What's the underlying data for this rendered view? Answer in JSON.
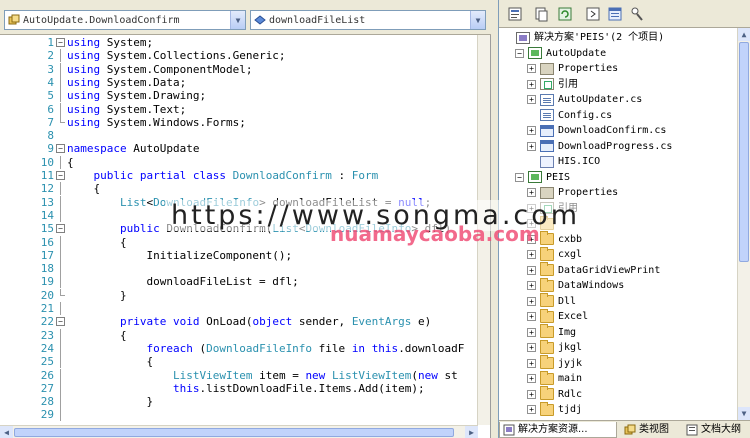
{
  "editor": {
    "class_combo": "AutoUpdate.DownloadConfirm",
    "member_combo": "downloadFileList",
    "lines": [
      {
        "n": "1",
        "fold": "minus",
        "tokens": [
          [
            "kw",
            "using"
          ],
          [
            "t",
            " System;"
          ]
        ]
      },
      {
        "n": "2",
        "fold": "line",
        "tokens": [
          [
            "kw",
            "using"
          ],
          [
            "t",
            " System.Collections.Generic;"
          ]
        ]
      },
      {
        "n": "3",
        "fold": "line",
        "tokens": [
          [
            "kw",
            "using"
          ],
          [
            "t",
            " System.ComponentModel;"
          ]
        ]
      },
      {
        "n": "4",
        "fold": "line",
        "tokens": [
          [
            "kw",
            "using"
          ],
          [
            "t",
            " System.Data;"
          ]
        ]
      },
      {
        "n": "5",
        "fold": "line",
        "tokens": [
          [
            "kw",
            "using"
          ],
          [
            "t",
            " System.Drawing;"
          ]
        ]
      },
      {
        "n": "6",
        "fold": "line",
        "tokens": [
          [
            "kw",
            "using"
          ],
          [
            "t",
            " System.Text;"
          ]
        ]
      },
      {
        "n": "7",
        "fold": "end",
        "tokens": [
          [
            "kw",
            "using"
          ],
          [
            "t",
            " System.Windows.Forms;"
          ]
        ]
      },
      {
        "n": "8",
        "fold": "",
        "tokens": []
      },
      {
        "n": "9",
        "fold": "minus",
        "tokens": [
          [
            "kw",
            "namespace"
          ],
          [
            "t",
            " AutoUpdate"
          ]
        ]
      },
      {
        "n": "10",
        "fold": "line",
        "tokens": [
          [
            "t",
            "{"
          ]
        ]
      },
      {
        "n": "11",
        "fold": "minus",
        "tokens": [
          [
            "t",
            "    "
          ],
          [
            "kw",
            "public partial class"
          ],
          [
            "t",
            " "
          ],
          [
            "ty",
            "DownloadConfirm"
          ],
          [
            "t",
            " : "
          ],
          [
            "ty",
            "Form"
          ]
        ]
      },
      {
        "n": "12",
        "fold": "line",
        "tokens": [
          [
            "t",
            "    {"
          ]
        ]
      },
      {
        "n": "13",
        "fold": "line",
        "tokens": [
          [
            "t",
            "        "
          ],
          [
            "ty",
            "List"
          ],
          [
            "t",
            "<"
          ],
          [
            "ty",
            "DownloadFileInfo"
          ],
          [
            "t",
            "> downloadFileList = "
          ],
          [
            "kw",
            "null"
          ],
          [
            "t",
            ";"
          ]
        ]
      },
      {
        "n": "14",
        "fold": "line",
        "tokens": []
      },
      {
        "n": "15",
        "fold": "minus",
        "tokens": [
          [
            "t",
            "        "
          ],
          [
            "kw",
            "public"
          ],
          [
            "t",
            " DownloadConfirm("
          ],
          [
            "ty",
            "List"
          ],
          [
            "t",
            "<"
          ],
          [
            "ty",
            "DownloadFileInfo"
          ],
          [
            "t",
            "> dfl)"
          ]
        ]
      },
      {
        "n": "16",
        "fold": "line",
        "tokens": [
          [
            "t",
            "        {"
          ]
        ]
      },
      {
        "n": "17",
        "fold": "line",
        "tokens": [
          [
            "t",
            "            InitializeComponent();"
          ]
        ]
      },
      {
        "n": "18",
        "fold": "line",
        "tokens": []
      },
      {
        "n": "19",
        "fold": "line",
        "tokens": [
          [
            "t",
            "            downloadFileList = dfl;"
          ]
        ]
      },
      {
        "n": "20",
        "fold": "end",
        "tokens": [
          [
            "t",
            "        }"
          ]
        ]
      },
      {
        "n": "21",
        "fold": "line",
        "tokens": []
      },
      {
        "n": "22",
        "fold": "minus",
        "tokens": [
          [
            "t",
            "        "
          ],
          [
            "kw",
            "private void"
          ],
          [
            "t",
            " OnLoad("
          ],
          [
            "kw",
            "object"
          ],
          [
            "t",
            " sender, "
          ],
          [
            "ty",
            "EventArgs"
          ],
          [
            "t",
            " e)"
          ]
        ]
      },
      {
        "n": "23",
        "fold": "line",
        "tokens": [
          [
            "t",
            "        {"
          ]
        ]
      },
      {
        "n": "24",
        "fold": "line",
        "tokens": [
          [
            "t",
            "            "
          ],
          [
            "kw",
            "foreach"
          ],
          [
            "t",
            " ("
          ],
          [
            "ty",
            "DownloadFileInfo"
          ],
          [
            "t",
            " file "
          ],
          [
            "kw",
            "in"
          ],
          [
            "t",
            " "
          ],
          [
            "kw",
            "this"
          ],
          [
            "t",
            ".downloadF"
          ]
        ]
      },
      {
        "n": "25",
        "fold": "line",
        "tokens": [
          [
            "t",
            "            {"
          ]
        ]
      },
      {
        "n": "26",
        "fold": "line",
        "tokens": [
          [
            "t",
            "                "
          ],
          [
            "ty",
            "ListViewItem"
          ],
          [
            "t",
            " item = "
          ],
          [
            "kw",
            "new"
          ],
          [
            "t",
            " "
          ],
          [
            "ty",
            "ListViewItem"
          ],
          [
            "t",
            "("
          ],
          [
            "kw",
            "new"
          ],
          [
            "t",
            " st"
          ]
        ]
      },
      {
        "n": "27",
        "fold": "line",
        "tokens": [
          [
            "t",
            "                "
          ],
          [
            "kw",
            "this"
          ],
          [
            "t",
            ".listDownloadFile.Items.Add(item);"
          ]
        ]
      },
      {
        "n": "28",
        "fold": "line",
        "tokens": [
          [
            "t",
            "            }"
          ]
        ]
      },
      {
        "n": "29",
        "fold": "line",
        "tokens": []
      }
    ]
  },
  "solution": {
    "nodes": [
      {
        "indent": 0,
        "exp": "",
        "icon": "sln",
        "label": "解决方案'PEIS'(2 个项目)",
        "name": "solution-root"
      },
      {
        "indent": 1,
        "exp": "-",
        "icon": "proj",
        "label": "AutoUpdate",
        "name": "project-autoupdate"
      },
      {
        "indent": 2,
        "exp": "+",
        "icon": "props",
        "label": "Properties",
        "name": "node-properties"
      },
      {
        "indent": 2,
        "exp": "+",
        "icon": "refs",
        "label": "引用",
        "name": "node-references"
      },
      {
        "indent": 2,
        "exp": "+",
        "icon": "cs",
        "label": "AutoUpdater.cs",
        "name": "file-autoupdater"
      },
      {
        "indent": 2,
        "exp": "",
        "icon": "cs",
        "label": "Config.cs",
        "name": "file-config"
      },
      {
        "indent": 2,
        "exp": "+",
        "icon": "form",
        "label": "DownloadConfirm.cs",
        "name": "file-downloadconfirm"
      },
      {
        "indent": 2,
        "exp": "+",
        "icon": "form",
        "label": "DownloadProgress.cs",
        "name": "file-downloadprogress"
      },
      {
        "indent": 2,
        "exp": "",
        "icon": "file",
        "label": "HIS.ICO",
        "name": "file-his-ico"
      },
      {
        "indent": 1,
        "exp": "-",
        "icon": "proj",
        "label": "PEIS",
        "name": "project-peis"
      },
      {
        "indent": 2,
        "exp": "+",
        "icon": "props",
        "label": "Properties",
        "name": "node-properties"
      },
      {
        "indent": 2,
        "exp": "+",
        "icon": "refs",
        "label": "引用",
        "name": "node-references"
      },
      {
        "indent": 2,
        "exp": "+",
        "icon": "folder",
        "label": "",
        "name": "folder-item"
      },
      {
        "indent": 2,
        "exp": "+",
        "icon": "folder",
        "label": "cxbb",
        "name": "folder-item"
      },
      {
        "indent": 2,
        "exp": "+",
        "icon": "folder",
        "label": "cxgl",
        "name": "folder-item"
      },
      {
        "indent": 2,
        "exp": "+",
        "icon": "folder",
        "label": "DataGridViewPrint",
        "name": "folder-item"
      },
      {
        "indent": 2,
        "exp": "+",
        "icon": "folder",
        "label": "DataWindows",
        "name": "folder-item"
      },
      {
        "indent": 2,
        "exp": "+",
        "icon": "folder",
        "label": "Dll",
        "name": "folder-item"
      },
      {
        "indent": 2,
        "exp": "+",
        "icon": "folder",
        "label": "Excel",
        "name": "folder-item"
      },
      {
        "indent": 2,
        "exp": "+",
        "icon": "folder",
        "label": "Img",
        "name": "folder-item"
      },
      {
        "indent": 2,
        "exp": "+",
        "icon": "folder",
        "label": "jkgl",
        "name": "folder-item"
      },
      {
        "indent": 2,
        "exp": "+",
        "icon": "folder",
        "label": "jyjk",
        "name": "folder-item"
      },
      {
        "indent": 2,
        "exp": "+",
        "icon": "folder",
        "label": "main",
        "name": "folder-item"
      },
      {
        "indent": 2,
        "exp": "+",
        "icon": "folder",
        "label": "Rdlc",
        "name": "folder-item"
      },
      {
        "indent": 2,
        "exp": "+",
        "icon": "folder",
        "label": "tjdj",
        "name": "folder-item"
      }
    ],
    "tabs": {
      "solution_explorer": "解决方案资源...",
      "class_view": "类视图",
      "document_outline": "文档大纲"
    }
  },
  "watermark": {
    "url": "https://www.songma.com",
    "cn": "nuamaycaoba.com"
  }
}
